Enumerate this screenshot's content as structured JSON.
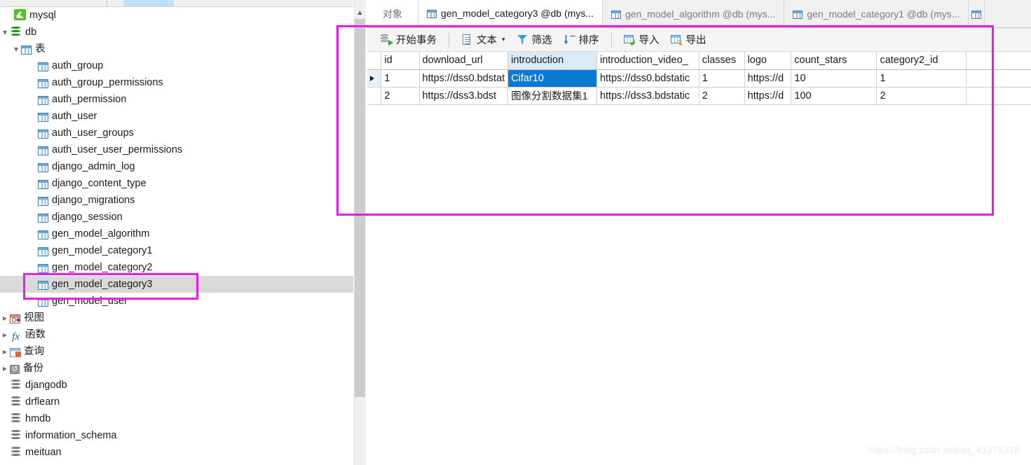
{
  "sidebar": {
    "connection": {
      "label": "mysql",
      "icon": "mysql-dolphin-icon"
    },
    "database": {
      "label": "db",
      "icon": "database-green-icon",
      "expanded": true
    },
    "tables_group": {
      "label": "表",
      "icon": "table-group-icon",
      "expanded": true
    },
    "tables": [
      "auth_group",
      "auth_group_permissions",
      "auth_permission",
      "auth_user",
      "auth_user_groups",
      "auth_user_user_permissions",
      "django_admin_log",
      "django_content_type",
      "django_migrations",
      "django_session",
      "gen_model_algorithm",
      "gen_model_category1",
      "gen_model_category2",
      "gen_model_category3",
      "gen_model_user"
    ],
    "selected_table": "gen_model_category3",
    "groups": [
      {
        "label": "视图",
        "icon": "view-icon"
      },
      {
        "label": "函数",
        "icon": "function-fx-icon"
      },
      {
        "label": "查询",
        "icon": "query-icon"
      },
      {
        "label": "备份",
        "icon": "backup-icon"
      }
    ],
    "other_databases": [
      "djangodb",
      "drflearn",
      "hmdb",
      "information_schema",
      "meituan"
    ]
  },
  "tabs": {
    "objects_label": "对象",
    "items": [
      {
        "label": "gen_model_category3 @db (mys...",
        "active": true
      },
      {
        "label": "gen_model_algorithm @db (mys...",
        "active": false
      },
      {
        "label": "gen_model_category1 @db (mys...",
        "active": false
      }
    ]
  },
  "toolbar": {
    "begin_transaction": "开始事务",
    "text": "文本",
    "filter": "筛选",
    "sort": "排序",
    "import": "导入",
    "export": "导出",
    "caret": "▾"
  },
  "grid": {
    "columns": [
      "id",
      "download_url",
      "introduction",
      "introduction_video_",
      "classes",
      "logo",
      "count_stars",
      "category2_id"
    ],
    "highlighted_column": "introduction",
    "selected_cell": {
      "row": 0,
      "column": "introduction"
    },
    "current_row_index": 0,
    "rows": [
      {
        "id": "1",
        "download_url": "https://dss0.bdstat",
        "introduction": "Cifar10",
        "introduction_video_": "https://dss0.bdstatic",
        "classes": "1",
        "logo": "https://d",
        "count_stars": "10",
        "category2_id": "1"
      },
      {
        "id": "2",
        "download_url": "https://dss3.bdst",
        "introduction": "图像分割数据集1",
        "introduction_video_": "https://dss3.bdstatic",
        "classes": "2",
        "logo": "https://d",
        "count_stars": "100",
        "category2_id": "2"
      }
    ]
  },
  "annotations": {
    "color": "#e81ce8",
    "grid_box": "highlight-around-data-grid",
    "tree_box": "highlight-around-gen_model_category3"
  },
  "watermark": "https://blog.csdn.net/qq_41375318"
}
